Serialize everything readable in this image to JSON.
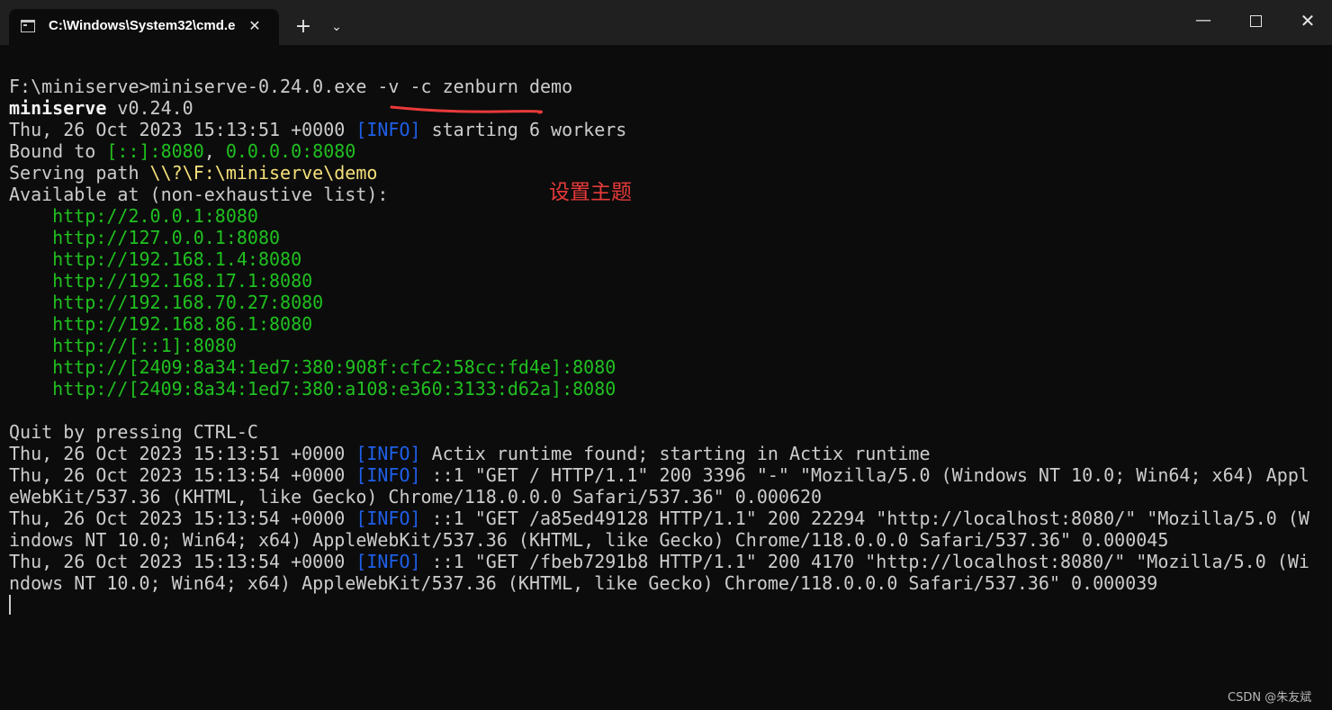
{
  "window": {
    "tab_title": "C:\\Windows\\System32\\cmd.e",
    "tab_close_glyph": "✕",
    "new_tab_glyph": "+",
    "tab_dropdown_glyph": "⌄",
    "minimize_glyph": "—",
    "close_glyph": "✕"
  },
  "terminal": {
    "command_line": "F:\\miniserve>miniserve-0.24.0.exe -v -c zenburn demo",
    "version_name": "miniserve",
    "version_num": " v0.24.0",
    "ts": "Thu, 26 Oct 2023 15:13:51 +0000 ",
    "info_tag": "[INFO]",
    "start_msg": " starting 6 workers",
    "bound_prefix": "Bound to ",
    "bound_addr1": "[::]:8080",
    "bound_sep": ", ",
    "bound_addr2": "0.0.0.0:8080",
    "serving_prefix": "Serving path ",
    "serving_path": "\\\\?\\F:\\miniserve\\demo",
    "available": "Available at (non-exhaustive list):",
    "urls": [
      "    http://2.0.0.1:8080",
      "    http://127.0.0.1:8080",
      "    http://192.168.1.4:8080",
      "    http://192.168.17.1:8080",
      "    http://192.168.70.27:8080",
      "    http://192.168.86.1:8080",
      "    http://[::1]:8080",
      "    http://[2409:8a34:1ed7:380:908f:cfc2:58cc:fd4e]:8080",
      "    http://[2409:8a34:1ed7:380:a108:e360:3133:d62a]:8080"
    ],
    "quit": "Quit by pressing CTRL-C",
    "log": [
      {
        "ts": "Thu, 26 Oct 2023 15:13:51 +0000 ",
        "tag": "[INFO]",
        "msg": " Actix runtime found; starting in Actix runtime"
      },
      {
        "ts": "Thu, 26 Oct 2023 15:13:54 +0000 ",
        "tag": "[INFO]",
        "msg": " ::1 \"GET / HTTP/1.1\" 200 3396 \"-\" \"Mozilla/5.0 (Windows NT 10.0; Win64; x64) Appl"
      },
      {
        "wrap": "eWebKit/537.36 (KHTML, like Gecko) Chrome/118.0.0.0 Safari/537.36\" 0.000620"
      },
      {
        "ts": "Thu, 26 Oct 2023 15:13:54 +0000 ",
        "tag": "[INFO]",
        "msg": " ::1 \"GET /a85ed49128 HTTP/1.1\" 200 22294 \"http://localhost:8080/\" \"Mozilla/5.0 (W"
      },
      {
        "wrap": "indows NT 10.0; Win64; x64) AppleWebKit/537.36 (KHTML, like Gecko) Chrome/118.0.0.0 Safari/537.36\" 0.000045"
      },
      {
        "ts": "Thu, 26 Oct 2023 15:13:54 +0000 ",
        "tag": "[INFO]",
        "msg": " ::1 \"GET /fbeb7291b8 HTTP/1.1\" 200 4170 \"http://localhost:8080/\" \"Mozilla/5.0 (Wi"
      },
      {
        "wrap": "ndows NT 10.0; Win64; x64) AppleWebKit/537.36 (KHTML, like Gecko) Chrome/118.0.0.0 Safari/537.36\" 0.000039"
      }
    ]
  },
  "annotation": {
    "text": "设置主题",
    "color": "#e83a3a"
  },
  "watermark": "CSDN @朱友斌",
  "colors": {
    "info": "#1f5fe8",
    "green": "#20c020",
    "yellow": "#f5e07a",
    "background": "#0c0c0c"
  }
}
